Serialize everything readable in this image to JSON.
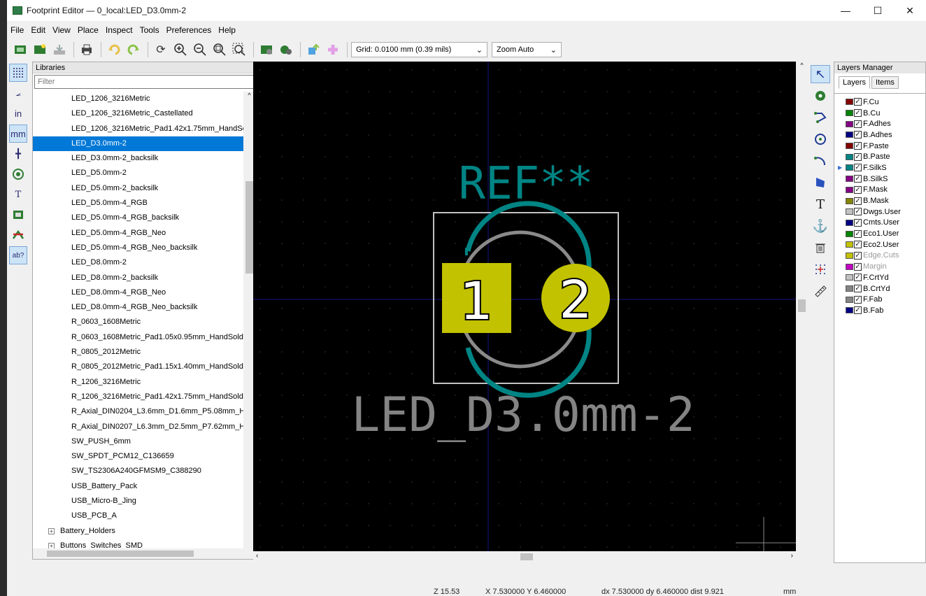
{
  "window": {
    "title": "Footprint Editor — 0_local:LED_D3.0mm-2",
    "min": "—",
    "max": "☐",
    "close": "✕"
  },
  "menu": [
    "File",
    "Edit",
    "View",
    "Place",
    "Inspect",
    "Tools",
    "Preferences",
    "Help"
  ],
  "toolbar": {
    "grid": "Grid: 0.0100 mm (0.39 mils)",
    "zoom": "Zoom Auto"
  },
  "libraries": {
    "caption": "Libraries",
    "filter_placeholder": "Filter",
    "items": [
      "LED_1206_3216Metric",
      "LED_1206_3216Metric_Castellated",
      "LED_1206_3216Metric_Pad1.42x1.75mm_HandSc",
      "LED_D3.0mm-2",
      "LED_D3.0mm-2_backsilk",
      "LED_D5.0mm-2",
      "LED_D5.0mm-2_backsilk",
      "LED_D5.0mm-4_RGB",
      "LED_D5.0mm-4_RGB_backsilk",
      "LED_D5.0mm-4_RGB_Neo",
      "LED_D5.0mm-4_RGB_Neo_backsilk",
      "LED_D8.0mm-2",
      "LED_D8.0mm-2_backsilk",
      "LED_D8.0mm-4_RGB_Neo",
      "LED_D8.0mm-4_RGB_Neo_backsilk",
      "R_0603_1608Metric",
      "R_0603_1608Metric_Pad1.05x0.95mm_HandSold",
      "R_0805_2012Metric",
      "R_0805_2012Metric_Pad1.15x1.40mm_HandSold",
      "R_1206_3216Metric",
      "R_1206_3216Metric_Pad1.42x1.75mm_HandSold",
      "R_Axial_DIN0204_L3.6mm_D1.6mm_P5.08mm_H",
      "R_Axial_DIN0207_L6.3mm_D2.5mm_P7.62mm_H",
      "SW_PUSH_6mm",
      "SW_SPDT_PCM12_C136659",
      "SW_TS2306A240GFMSM9_C388290",
      "USB_Battery_Pack",
      "USB_Micro-B_Jing",
      "USB_PCB_A"
    ],
    "selected_index": 3,
    "groups": [
      "Battery_Holders",
      "Buttons_Switches_SMD"
    ]
  },
  "footprint": {
    "reference": "REF**",
    "value": "LED_D3.0mm-2",
    "pad1": "1",
    "pad2": "2"
  },
  "layers_manager": {
    "caption": "Layers Manager",
    "tab_layers": "Layers",
    "tab_items": "Items",
    "layers": [
      {
        "name": "F.Cu",
        "color": "#840000"
      },
      {
        "name": "B.Cu",
        "color": "#008400"
      },
      {
        "name": "F.Adhes",
        "color": "#840084"
      },
      {
        "name": "B.Adhes",
        "color": "#000084"
      },
      {
        "name": "F.Paste",
        "color": "#840000"
      },
      {
        "name": "B.Paste",
        "color": "#008484"
      },
      {
        "name": "F.SilkS",
        "color": "#008484"
      },
      {
        "name": "B.SilkS",
        "color": "#840084"
      },
      {
        "name": "F.Mask",
        "color": "#840084"
      },
      {
        "name": "B.Mask",
        "color": "#848400"
      },
      {
        "name": "Dwgs.User",
        "color": "#c2c2c2"
      },
      {
        "name": "Cmts.User",
        "color": "#000084"
      },
      {
        "name": "Eco1.User",
        "color": "#008400"
      },
      {
        "name": "Eco2.User",
        "color": "#c2c200"
      },
      {
        "name": "Edge.Cuts",
        "color": "#c2c200"
      },
      {
        "name": "Margin",
        "color": "#c200c2"
      },
      {
        "name": "F.CrtYd",
        "color": "#c2c2c2"
      },
      {
        "name": "B.CrtYd",
        "color": "#848484"
      },
      {
        "name": "F.Fab",
        "color": "#848484"
      },
      {
        "name": "B.Fab",
        "color": "#000084"
      }
    ]
  },
  "status": {
    "zoom": "Z 15.53",
    "xy": "X 7.530000  Y 6.460000",
    "delta": "dx 7.530000  dy 6.460000  dist 9.921",
    "units": "mm"
  },
  "colors": {
    "silk": "#008080",
    "fab": "#848484",
    "pad": "#c2c200",
    "selection": "#0078d7"
  }
}
